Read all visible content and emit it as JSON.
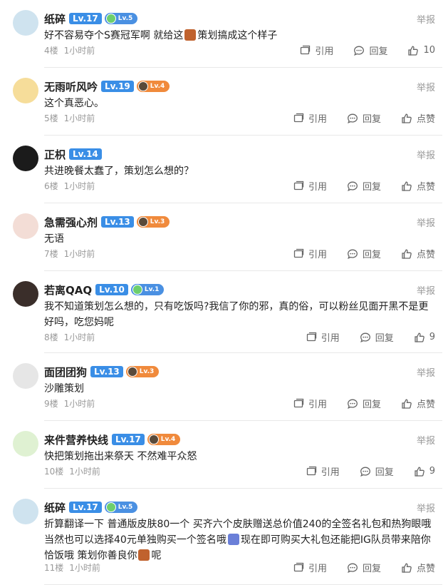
{
  "labels": {
    "report": "举报",
    "quote": "引用",
    "reply": "回复",
    "like": "点赞",
    "time": "1小时前"
  },
  "comments": [
    {
      "user": "纸碎",
      "level": "Lv.17",
      "badge": "Lv.5",
      "badge_color": "blue",
      "text_parts": [
        "好不容易夺个S赛冠军啊 就给这",
        "策划搞成这个样子"
      ],
      "floor": "4楼",
      "likes": "10",
      "avatar_color": "#cfe3ef"
    },
    {
      "user": "无雨听风吟",
      "level": "Lv.19",
      "badge": "Lv.4",
      "badge_color": "orange",
      "text_parts": [
        "这个真恶心。"
      ],
      "floor": "5楼",
      "likes": "点赞",
      "avatar_color": "#f6dd9a"
    },
    {
      "user": "正枳",
      "level": "Lv.14",
      "badge": "",
      "badge_color": "",
      "text_parts": [
        "共进晚餐太蠢了，策划怎么想的？"
      ],
      "floor": "6楼",
      "likes": "点赞",
      "avatar_color": "#1b1b1b"
    },
    {
      "user": "急需强心剂",
      "level": "Lv.13",
      "badge": "Lv.3",
      "badge_color": "orange",
      "text_parts": [
        "无语"
      ],
      "floor": "7楼",
      "likes": "点赞",
      "avatar_color": "#f3ddd6"
    },
    {
      "user": "若离QAQ",
      "level": "Lv.10",
      "badge": "Lv.1",
      "badge_color": "blue",
      "text_parts": [
        "我不知道策划怎么想的，只有吃饭吗?我信了你的邪，真的俗，可以粉丝见面开黑不是更好吗，吃您妈呢"
      ],
      "floor": "8楼",
      "likes": "9",
      "avatar_color": "#3a2e2a"
    },
    {
      "user": "面团团狗",
      "level": "Lv.13",
      "badge": "Lv.3",
      "badge_color": "orange",
      "text_parts": [
        "沙雕策划"
      ],
      "floor": "9楼",
      "likes": "点赞",
      "avatar_color": "#e6e6e6"
    },
    {
      "user": "来件营养快线",
      "level": "Lv.17",
      "badge": "Lv.4",
      "badge_color": "orange",
      "text_parts": [
        "快把策划拖出来祭天 不然难平众怒"
      ],
      "floor": "10楼",
      "likes": "9",
      "avatar_color": "#dff1d2"
    },
    {
      "user": "纸碎",
      "level": "Lv.17",
      "badge": "Lv.5",
      "badge_color": "blue",
      "text_parts": [
        "折算翻译一下 普通版皮肤80一个 买齐六个皮肤赠送总价值240的全签名礼包和热狗眼哦当然也可以选择40元单独购买一个签名哦",
        "现在即可购买大礼包还能把IG队员带来陪你恰饭哦 策划你善良你",
        "呢"
      ],
      "floor": "11楼",
      "likes": "点赞",
      "avatar_color": "#cfe3ef"
    }
  ]
}
